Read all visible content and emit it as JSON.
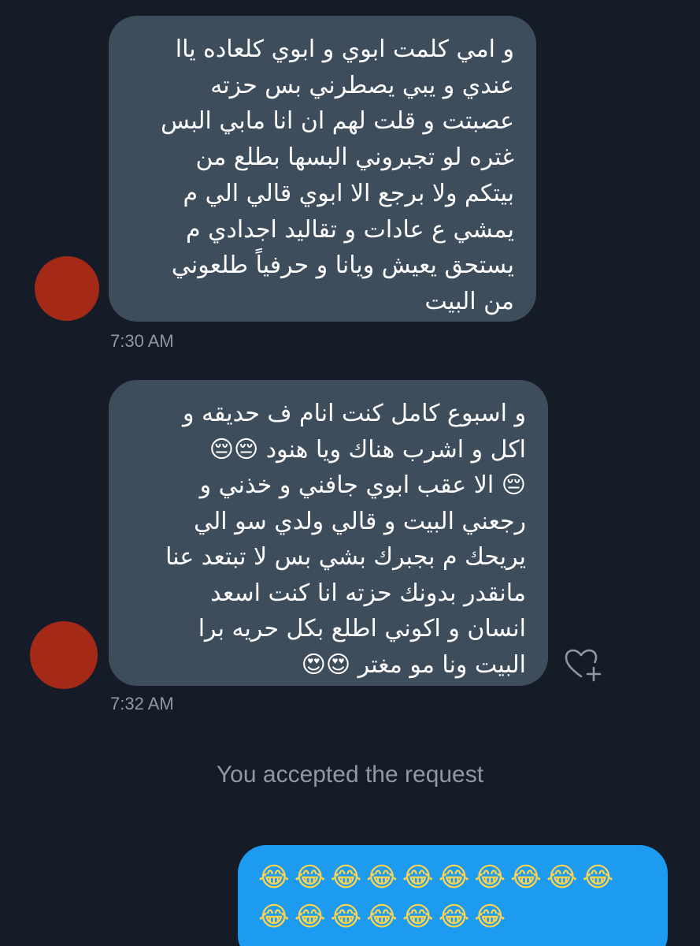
{
  "conversation": {
    "messages": [
      {
        "lines": [
          "و امي كلمت ابوي و ابوي كلعاده ياا",
          "عندي و يبي يصطرني بس حزته",
          "عصبتت و قلت لهم ان انا مابي البس",
          "غتره لو تجبروني البسها بطلع من",
          "بيتكم ولا برجع الا  ابوي قالي الي م",
          "يمشي ع عادات و تقاليد اجدادي م",
          "يستحق يعيش ويانا و حرفياً طلعوني",
          "من البيت"
        ],
        "timestamp": "7:30 AM"
      },
      {
        "lines": [
          "و اسبوع كامل كنت انام ف حديقه و",
          "اكل و اشرب هناك ويا هنود 😔😔",
          "😔 الا عقب ابوي جافني و خذني و",
          "رجعني البيت و قالي ولدي سو الي",
          "يريحك م بجبرك بشي بس لا تبتعد عنا",
          "مانقدر بدونك حزته انا كنت اسعد",
          "انسان و اكوني اطلع بكل حريه برا",
          "البيت ونا مو مغتر 😍😍"
        ],
        "timestamp": "7:32 AM"
      }
    ],
    "system_note": "You accepted the request",
    "sent": {
      "rows": [
        "😂😂😂😂😂😂😂😂😂😂",
        "😂😂😂😂😂😂😂"
      ]
    }
  },
  "icons": {
    "like": "heart-plus-icon"
  },
  "colors": {
    "background": "#151c27",
    "received_bubble": "#3e4d5c",
    "sent_bubble": "#1d9bf0",
    "meta_text": "#8e99a6",
    "avatar": "#a52917"
  }
}
